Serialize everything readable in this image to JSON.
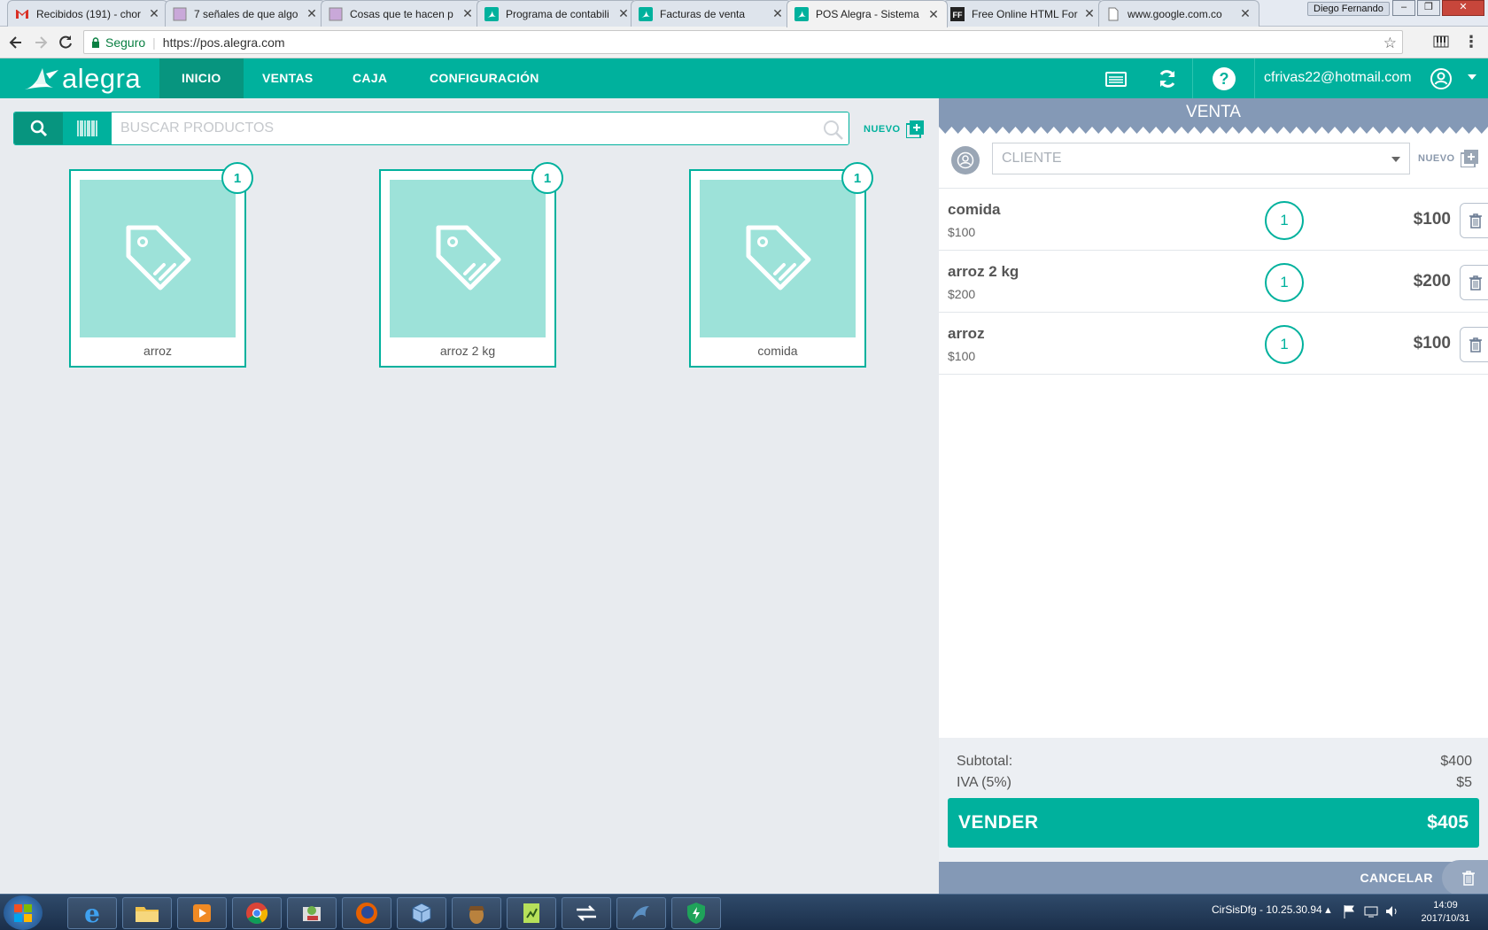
{
  "browser": {
    "tabs": [
      {
        "title": "Recibidos (191) - chor",
        "icon": "gmail-icon"
      },
      {
        "title": "7 señales de que algo",
        "icon": "page-icon"
      },
      {
        "title": "Cosas que te hacen p",
        "icon": "page-icon"
      },
      {
        "title": "Programa de contabili",
        "icon": "alegra-icon"
      },
      {
        "title": "Facturas de venta",
        "icon": "alegra-icon"
      },
      {
        "title": "POS Alegra - Sistema",
        "icon": "alegra-icon",
        "active": true
      },
      {
        "title": "Free Online HTML For",
        "icon": "ff-icon"
      },
      {
        "title": "www.google.com.co",
        "icon": "doc-icon"
      }
    ],
    "profile": "Diego Fernando",
    "secure_label": "Seguro",
    "url": "https://pos.alegra.com"
  },
  "app": {
    "logo": "alegra",
    "nav": [
      "INICIO",
      "VENTAS",
      "CAJA",
      "CONFIGURACIÓN"
    ],
    "user_email": "cfrivas22@hotmail.com",
    "accent": "#00b19d"
  },
  "search": {
    "placeholder": "BUSCAR PRODUCTOS",
    "new_label": "NUEVO"
  },
  "products": [
    {
      "name": "arroz",
      "count": "1"
    },
    {
      "name": "arroz 2 kg",
      "count": "1"
    },
    {
      "name": "comida",
      "count": "1"
    }
  ],
  "sale": {
    "title": "VENTA",
    "client_placeholder": "CLIENTE",
    "new_label": "NUEVO",
    "items": [
      {
        "name": "comida",
        "price": "$100",
        "qty": "1",
        "total": "$100"
      },
      {
        "name": "arroz 2 kg",
        "price": "$200",
        "qty": "1",
        "total": "$200"
      },
      {
        "name": "arroz",
        "price": "$100",
        "qty": "1",
        "total": "$100"
      }
    ],
    "subtotal_label": "Subtotal:",
    "subtotal": "$400",
    "tax_label": "IVA (5%)",
    "tax": "$5",
    "sell_label": "VENDER",
    "total": "$405",
    "cancel_label": "CANCELAR"
  },
  "taskbar": {
    "network": "CirSisDfg - 10.25.30.94",
    "time": "14:09",
    "date": "2017/10/31"
  }
}
